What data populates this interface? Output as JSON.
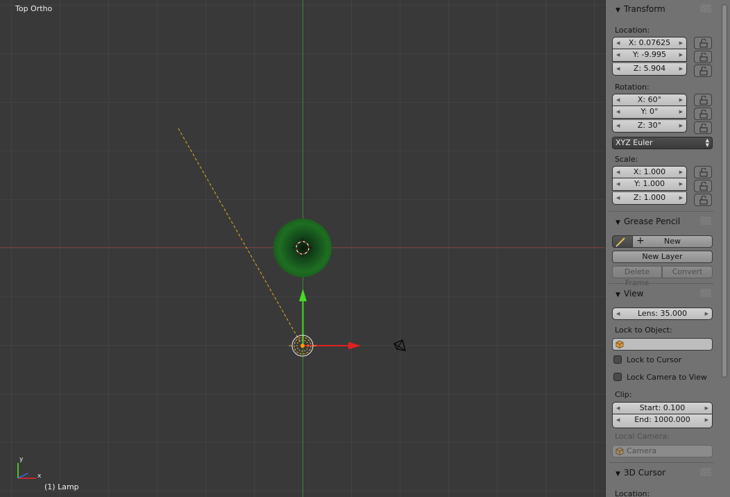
{
  "viewport": {
    "view_name": "Top Ortho",
    "object_label": "(1) Lamp",
    "axis_gizmo": {
      "x_label": "x",
      "y_label": "y"
    },
    "colors": {
      "x_axis": "#ee2828",
      "y_axis": "#55ee22",
      "lamp_ray": "#e8b020",
      "sphere": "#1e6e1e"
    }
  },
  "transform": {
    "title": "Transform",
    "location_label": "Location:",
    "location": [
      "X: 0.07625",
      "Y: -9.995",
      "Z: 5.904"
    ],
    "rotation_label": "Rotation:",
    "rotation": [
      "X: 60°",
      "Y: 0°",
      "Z: 30°"
    ],
    "rotation_mode": "XYZ Euler",
    "scale_label": "Scale:",
    "scale": [
      "X: 1.000",
      "Y: 1.000",
      "Z: 1.000"
    ]
  },
  "grease_pencil": {
    "title": "Grease Pencil",
    "new_label": "New",
    "new_layer_label": "New Layer",
    "delete_frame_label": "Delete Frame",
    "convert_label": "Convert"
  },
  "view": {
    "title": "View",
    "lens": "Lens: 35.000",
    "lock_to_object_label": "Lock to Object:",
    "lock_to_cursor_label": "Lock to Cursor",
    "lock_camera_label": "Lock Camera to View",
    "clip_label": "Clip:",
    "clip_start": "Start: 0.100",
    "clip_end": "End: 1000.000",
    "local_camera_label": "Local Camera:",
    "local_camera_value": "Camera"
  },
  "cursor": {
    "title": "3D Cursor",
    "location_label": "Location:"
  }
}
